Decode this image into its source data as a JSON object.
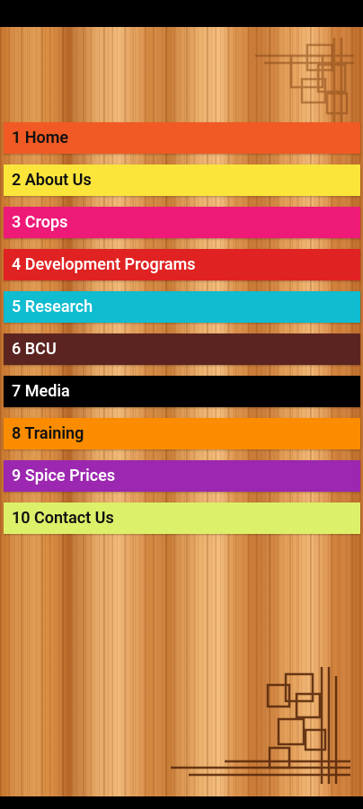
{
  "menu": {
    "items": [
      {
        "label": "1 Home",
        "bg": "#f15a24",
        "fg": "#111111"
      },
      {
        "label": "2 About Us",
        "bg": "#fbe53b",
        "fg": "#111111"
      },
      {
        "label": "3 Crops",
        "bg": "#ee1a78",
        "fg": "#ffffff"
      },
      {
        "label": "4 Development Programs",
        "bg": "#e02222",
        "fg": "#ffffff"
      },
      {
        "label": "5 Research",
        "bg": "#0fbcd0",
        "fg": "#ffffff"
      },
      {
        "label": "6 BCU",
        "bg": "#5b2421",
        "fg": "#ffffff"
      },
      {
        "label": "7 Media",
        "bg": "#000000",
        "fg": "#ffffff"
      },
      {
        "label": "8 Training",
        "bg": "#fb8c00",
        "fg": "#111111"
      },
      {
        "label": "9 Spice Prices",
        "bg": "#9c27b0",
        "fg": "#ffffff"
      },
      {
        "label": "10 Contact Us",
        "bg": "#ddf06a",
        "fg": "#111111"
      }
    ]
  },
  "background": {
    "texture": "wood",
    "ornament_color": "#5a2a0c"
  }
}
